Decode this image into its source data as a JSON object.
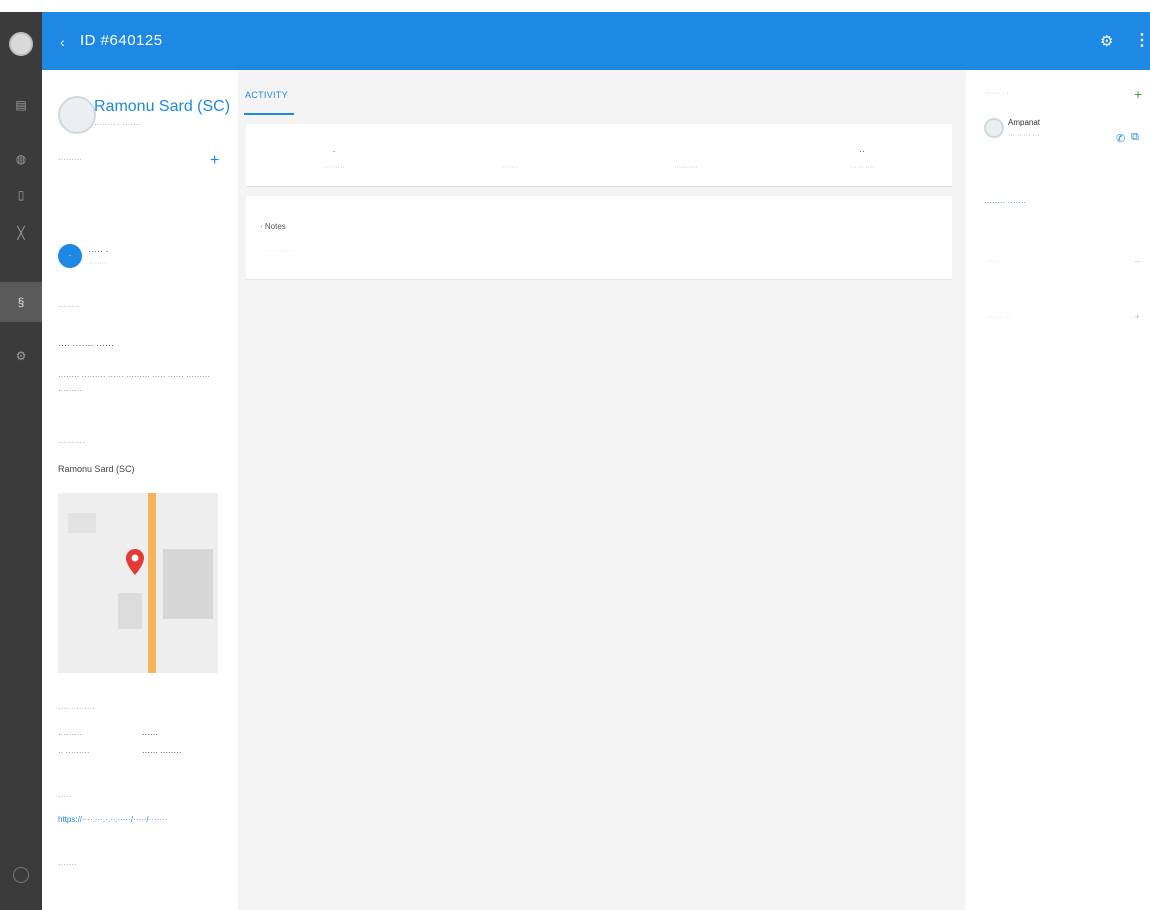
{
  "header": {
    "back_glyph": "‹",
    "title": "ID #640125",
    "gear_glyph": "⚙",
    "more_glyph": "⋮",
    "accent": "#1e88e5"
  },
  "rail": {
    "background": "#3b3b3b",
    "icons": [
      "list-icon",
      "globe-icon",
      "document-icon",
      "chart-icon",
      "person-icon",
      "settings-icon"
    ]
  },
  "left_panel": {
    "name": "Ramonu Sard (SC)",
    "subtitle": "········ · ·······",
    "section_label_1": "·········",
    "plus": "+",
    "badge_initials": "·",
    "badge_text": "····· ·",
    "badge_sub": "·· ·····",
    "label_2": "········",
    "heading_1": "···· ······· ······",
    "paragraph": "········ ········· ······ ········· ····· ······ ········· ·········",
    "label_3": "··········",
    "location_name": "Ramonu Sard (SC)",
    "details_label": "···· ·········",
    "kv": [
      {
        "label": "·········",
        "value": "······"
      },
      {
        "label": "·· ·········",
        "value": "······ ········"
      }
    ],
    "label_4": "·····",
    "link": "https://····.···.·.··.·····/·····/·······",
    "label_5": "·······"
  },
  "center": {
    "tab_label": "ACTIVITY",
    "stats": [
      {
        "number": "·",
        "label": "·········"
      },
      {
        "number": "",
        "label": "·······"
      },
      {
        "number": "",
        "label": "··········"
      },
      {
        "number": "··",
        "label": "··· ·· ····"
      }
    ],
    "notes_header": "· Notes",
    "notes_placeholder": "··· ···· ·····"
  },
  "right_panel": {
    "label": "······· · ·",
    "plus": "+",
    "contact_name": "Ampanat",
    "contact_phone": "··· ·· ··· ···",
    "phone_glyph": "✆",
    "copy_glyph": "⧉",
    "link": "········ ·······",
    "rows": [
      {
        "text": "·····",
        "glyph": "–"
      },
      {
        "text": "······ ···",
        "glyph": "+"
      }
    ]
  }
}
